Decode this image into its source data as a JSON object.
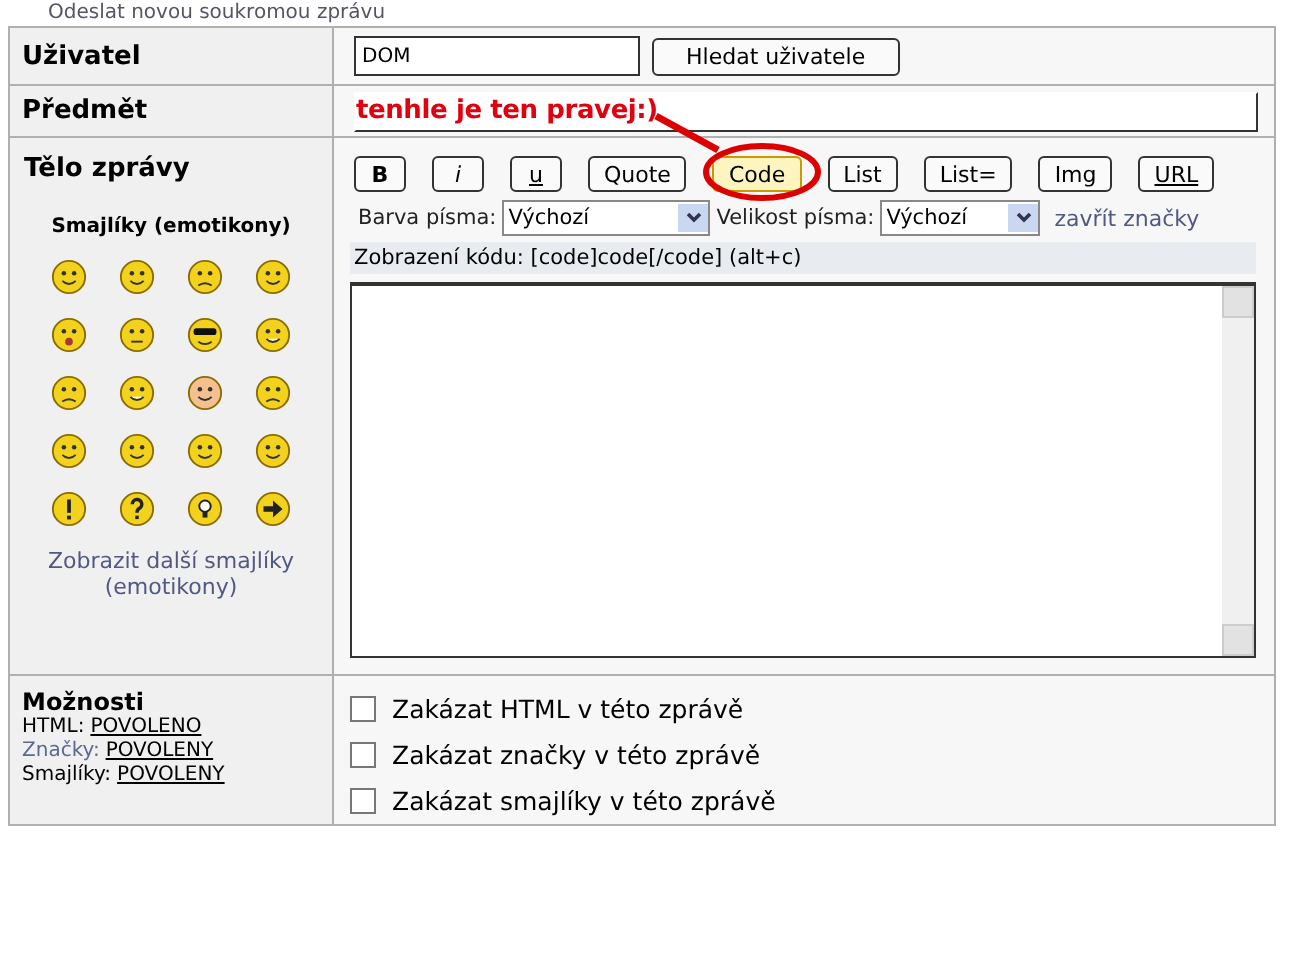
{
  "page_heading": "Odeslat novou soukromou zprávu",
  "user_row": {
    "label": "Uživatel",
    "value": "DOM",
    "button": "Hledat uživatele"
  },
  "subject_row": {
    "label": "Předmět",
    "value": "tenhle je ten pravej:)"
  },
  "body_row": {
    "label": "Tělo zprávy",
    "smileys_title": "Smajlíky (emotikony)",
    "more_smileys": "Zobrazit další smajlíky (emotikony)",
    "format_buttons": [
      {
        "label": "B",
        "kind": "bold",
        "selected": false
      },
      {
        "label": "i",
        "kind": "italic",
        "selected": false
      },
      {
        "label": "u",
        "kind": "underline",
        "selected": false
      },
      {
        "label": "Quote",
        "kind": "plain",
        "selected": false
      },
      {
        "label": "Code",
        "kind": "plain",
        "selected": true
      },
      {
        "label": "List",
        "kind": "plain",
        "selected": false
      },
      {
        "label": "List=",
        "kind": "plain",
        "selected": false
      },
      {
        "label": "Img",
        "kind": "plain",
        "selected": false
      },
      {
        "label": "URL",
        "kind": "underline",
        "selected": false
      }
    ],
    "font_color": {
      "label": "Barva písma:",
      "value": "Výchozí"
    },
    "font_size": {
      "label": "Velikost písma:",
      "value": "Výchozí"
    },
    "close_tags": "zavřít značky",
    "help_line": "Zobrazení kódu: [code]code[/code]  (alt+c)"
  },
  "options_row": {
    "label": "Možnosti",
    "info": [
      {
        "label": "HTML:",
        "value": "POVOLENO"
      },
      {
        "label": "Značky:",
        "value": "POVOLENY"
      },
      {
        "label": "Smajlíky:",
        "value": "POVOLENY"
      }
    ],
    "checkboxes": [
      {
        "label": "Zakázat HTML v této zprávě",
        "checked": false
      },
      {
        "label": "Zakázat značky v této zprávě",
        "checked": false
      },
      {
        "label": "Zakázat smajlíky v této zprávě",
        "checked": false
      }
    ]
  }
}
